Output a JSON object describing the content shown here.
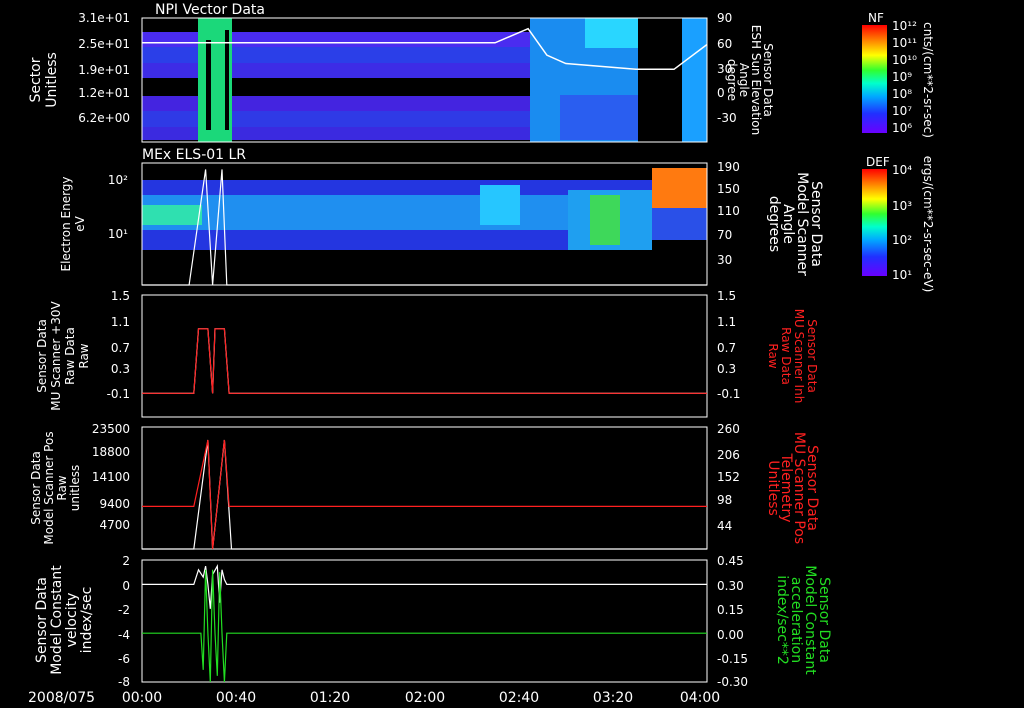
{
  "date": "2008/075",
  "time_ticks": [
    "00:00",
    "00:40",
    "01:20",
    "02:00",
    "02:40",
    "03:20",
    "04:00"
  ],
  "panels": [
    {
      "id": "npi",
      "title": "NPI Vector Data",
      "left_label": [
        "Sector",
        "Unitless"
      ],
      "left_ticks": [
        "3.1e+01",
        "2.5e+01",
        "1.9e+01",
        "1.2e+01",
        "6.2e+00"
      ],
      "right_ticks": [
        "90",
        "60",
        "30",
        "0",
        "-30"
      ],
      "right_label": [
        "Sensor Data",
        "ESH Sun Elevation",
        "Angle",
        "degree"
      ],
      "colorbar_title": "NF",
      "colorbar_ticks": [
        "10¹²",
        "10¹¹",
        "10¹⁰",
        "10⁹",
        "10⁸",
        "10⁷",
        "10⁶"
      ],
      "colorbar_units": "cnts/(cm**2-sr-sec)"
    },
    {
      "id": "els",
      "title": "MEx ELS-01 LR",
      "left_label": [
        "Electron Energy",
        "eV"
      ],
      "left_ticks": [
        "10²",
        "10¹"
      ],
      "right_ticks": [
        "190",
        "150",
        "110",
        "70",
        "30"
      ],
      "right_label": [
        "Sensor Data",
        "Model Scanner",
        "Angle",
        "degrees"
      ],
      "colorbar_title": "DEF",
      "colorbar_ticks": [
        "10⁴",
        "10³",
        "10²",
        "10¹"
      ],
      "colorbar_units": "ergs/(cm**2-sr-sec-eV)"
    },
    {
      "id": "mu30",
      "left_label": [
        "Sensor Data",
        "MU Scanner +30V",
        "Raw Data",
        "Raw"
      ],
      "left_ticks": [
        "1.5",
        "1.1",
        "0.7",
        "0.3",
        "-0.1"
      ],
      "right_ticks": [
        "1.5",
        "1.1",
        "0.7",
        "0.3",
        "-0.1"
      ],
      "right_label": [
        "Sensor Data",
        "MU Scanner Inh",
        "Raw Data",
        "Raw"
      ]
    },
    {
      "id": "pos",
      "left_label": [
        "Sensor Data",
        "Model Scanner Pos",
        "Raw",
        "unitless"
      ],
      "left_ticks": [
        "23500",
        "18800",
        "14100",
        "9400",
        "4700"
      ],
      "right_ticks": [
        "260",
        "206",
        "152",
        "98",
        "44"
      ],
      "right_label": [
        "Sensor Data",
        "MU Scanner Pos",
        "Telemetry",
        "Unitless"
      ]
    },
    {
      "id": "vel",
      "left_label": [
        "Sensor Data",
        "Model Constant",
        "velocity",
        "index/sec"
      ],
      "left_ticks": [
        "2",
        "0",
        "-2",
        "-4",
        "-6",
        "-8"
      ],
      "right_ticks": [
        "0.45",
        "0.30",
        "0.15",
        "0.00",
        "-0.15",
        "-0.30"
      ],
      "right_label": [
        "Sensor Data",
        "Model Constant",
        "acceleration",
        "index/sec**2"
      ]
    }
  ],
  "chart_data": [
    {
      "type": "heatmap",
      "title": "NPI Vector Data",
      "xlim": [
        "00:00",
        "04:00"
      ],
      "y_ticks": [
        31,
        25,
        19,
        12,
        6.2
      ],
      "overlay_series": {
        "name": "ESH Sun Elevation Angle",
        "points": [
          [
            "00:00",
            60
          ],
          [
            "00:36",
            60
          ],
          [
            "02:30",
            60
          ],
          [
            "02:44",
            77
          ],
          [
            "02:52",
            45
          ],
          [
            "03:00",
            35
          ],
          [
            "03:30",
            28
          ],
          [
            "03:46",
            28
          ],
          [
            "04:00",
            58
          ]
        ],
        "ylim": [
          -60,
          90
        ]
      },
      "data_gaps": [
        [
          "00:22",
          "00:32"
        ],
        [
          "03:26",
          "03:42"
        ]
      ]
    },
    {
      "type": "heatmap",
      "title": "MEx ELS-01 LR",
      "xlim": [
        "00:00",
        "04:00"
      ],
      "overlay_series": {
        "name": "Model Scanner Angle",
        "points": [
          [
            "00:00",
            0
          ],
          [
            "00:20",
            0
          ],
          [
            "00:27",
            180
          ],
          [
            "00:30",
            0
          ],
          [
            "00:34",
            180
          ],
          [
            "00:36",
            0
          ],
          [
            "04:00",
            0
          ]
        ],
        "ylim": [
          0,
          190
        ]
      }
    },
    {
      "type": "line",
      "xlim": [
        "00:00",
        "04:00"
      ],
      "ylim": [
        -0.3,
        1.5
      ],
      "series": [
        {
          "name": "MU Scanner +30V",
          "color": "#ffffff",
          "points": [
            [
              "00:00",
              0.05
            ],
            [
              "00:22",
              0.05
            ],
            [
              "00:24",
              1.0
            ],
            [
              "00:28",
              1.0
            ],
            [
              "00:30",
              0.05
            ],
            [
              "00:31",
              1.0
            ],
            [
              "00:35",
              1.0
            ],
            [
              "00:37",
              0.05
            ],
            [
              "04:00",
              0.05
            ]
          ]
        },
        {
          "name": "MU Scanner Inh",
          "color": "#ff2020",
          "points": [
            [
              "00:00",
              0.05
            ],
            [
              "00:22",
              0.05
            ],
            [
              "00:24",
              1.0
            ],
            [
              "00:28",
              1.0
            ],
            [
              "00:30",
              0.05
            ],
            [
              "00:31",
              1.0
            ],
            [
              "00:35",
              1.0
            ],
            [
              "00:37",
              0.05
            ],
            [
              "04:00",
              0.05
            ]
          ]
        }
      ]
    },
    {
      "type": "line",
      "xlim": [
        "00:00",
        "04:00"
      ],
      "ylim": [
        0,
        23500
      ],
      "series": [
        {
          "name": "Model Scanner Pos",
          "color": "#ffffff",
          "points": [
            [
              "00:00",
              0
            ],
            [
              "00:22",
              0
            ],
            [
              "00:28",
              21000
            ],
            [
              "00:30",
              0
            ],
            [
              "00:35",
              21000
            ],
            [
              "00:38",
              0
            ],
            [
              "04:00",
              0
            ]
          ]
        },
        {
          "name": "MU Scanner Pos Telemetry",
          "color": "#ff2020",
          "points": [
            [
              "00:00",
              8200
            ],
            [
              "00:22",
              8200
            ],
            [
              "00:28",
              21000
            ],
            [
              "00:30",
              0
            ],
            [
              "00:35",
              21000
            ],
            [
              "00:37",
              8200
            ],
            [
              "04:00",
              8200
            ]
          ]
        }
      ]
    },
    {
      "type": "line",
      "xlim": [
        "00:00",
        "04:00"
      ],
      "ylim": [
        -8,
        2
      ],
      "series": [
        {
          "name": "Model Constant velocity",
          "color": "#ffffff",
          "points": [
            [
              "00:00",
              0
            ],
            [
              "00:22",
              0
            ],
            [
              "00:24",
              1.2
            ],
            [
              "00:26",
              0.6
            ],
            [
              "00:27",
              1.5
            ],
            [
              "00:28",
              0
            ],
            [
              "00:29",
              -2
            ],
            [
              "00:30",
              0.8
            ],
            [
              "00:32",
              1.5
            ],
            [
              "00:33",
              -1.5
            ],
            [
              "00:34",
              1.2
            ],
            [
              "00:35",
              0.4
            ],
            [
              "00:36",
              0
            ],
            [
              "04:00",
              0
            ]
          ]
        },
        {
          "name": "Model Constant acceleration",
          "color": "#22dd22",
          "points": [
            [
              "00:00",
              -4
            ],
            [
              "00:25",
              -4
            ],
            [
              "00:26",
              -7
            ],
            [
              "00:27",
              1.2
            ],
            [
              "00:28",
              -4
            ],
            [
              "00:29",
              -8
            ],
            [
              "00:30",
              1.2
            ],
            [
              "00:31",
              -4
            ],
            [
              "00:32",
              -7.5
            ],
            [
              "00:33",
              1.0
            ],
            [
              "00:34",
              -4
            ],
            [
              "00:35",
              -8
            ],
            [
              "00:36",
              -4
            ],
            [
              "04:00",
              -4
            ]
          ]
        }
      ]
    }
  ]
}
